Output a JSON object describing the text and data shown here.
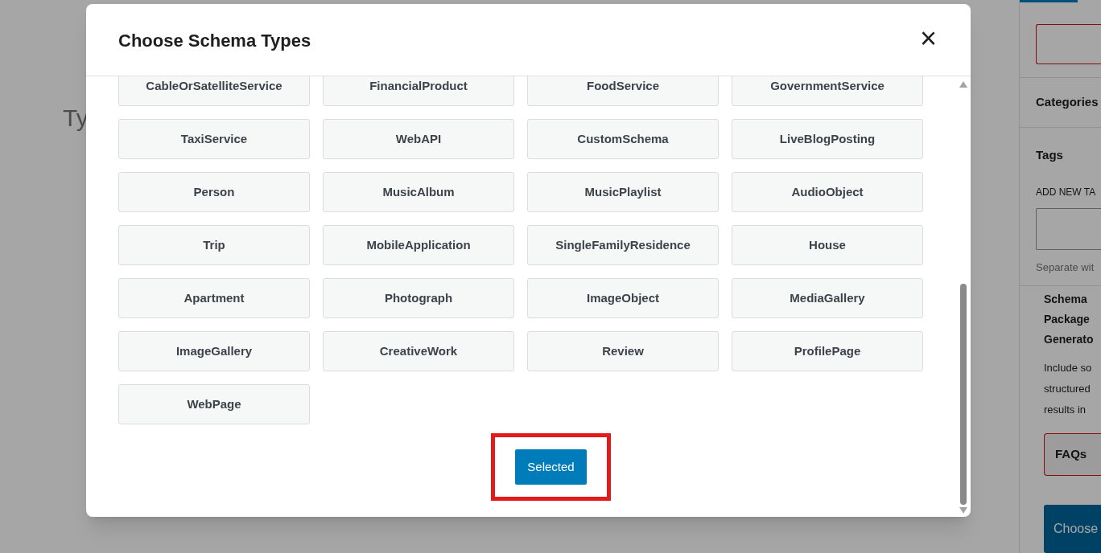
{
  "page": {
    "subtitle_fragment": "Ty"
  },
  "sidebar": {
    "categories_label": "Categories",
    "tags_label": "Tags",
    "add_new_tag_label": "ADD NEW TA",
    "tag_hint": "Separate wit",
    "schema_title": "Schema Package Generato",
    "schema_text": "Include so structured results in",
    "faqs_label": "FAQs",
    "choose_button": "Choose"
  },
  "modal": {
    "title": "Choose Schema Types",
    "close": "×",
    "types": [
      {
        "label": "CableOrSatelliteService"
      },
      {
        "label": "FinancialProduct"
      },
      {
        "label": "FoodService"
      },
      {
        "label": "GovernmentService"
      },
      {
        "label": "TaxiService"
      },
      {
        "label": "WebAPI"
      },
      {
        "label": "CustomSchema"
      },
      {
        "label": "LiveBlogPosting"
      },
      {
        "label": "Person"
      },
      {
        "label": "MusicAlbum"
      },
      {
        "label": "MusicPlaylist"
      },
      {
        "label": "AudioObject"
      },
      {
        "label": "Trip"
      },
      {
        "label": "MobileApplication"
      },
      {
        "label": "SingleFamilyResidence"
      },
      {
        "label": "House"
      },
      {
        "label": "Apartment"
      },
      {
        "label": "Photograph"
      },
      {
        "label": "ImageObject"
      },
      {
        "label": "MediaGallery"
      },
      {
        "label": "ImageGallery"
      },
      {
        "label": "CreativeWork"
      },
      {
        "label": "Review"
      },
      {
        "label": "ProfilePage"
      },
      {
        "label": "WebPage"
      }
    ],
    "submit": {
      "label": "Selected",
      "highlighted": true
    }
  }
}
